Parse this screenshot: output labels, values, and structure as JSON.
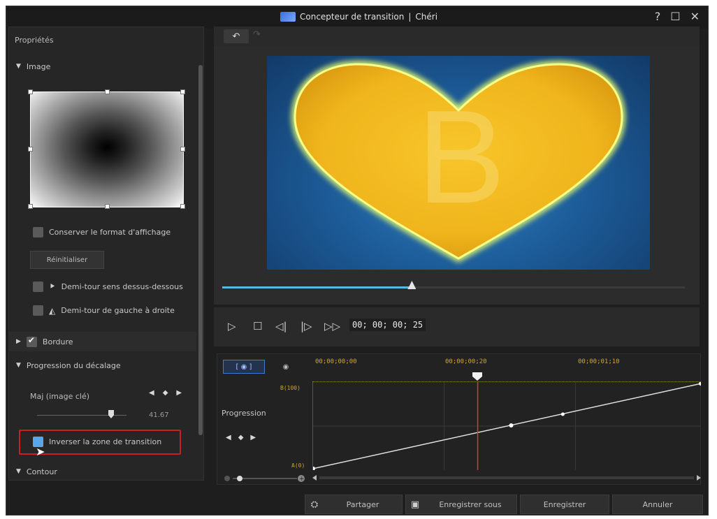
{
  "window": {
    "title": "Concepteur de transition",
    "project": "Chéri",
    "separator": "|",
    "controls": {
      "help": "?",
      "maximize": "☐",
      "close": "✕"
    }
  },
  "left_panel": {
    "heading": "Propriétés",
    "image_section": {
      "label": "Image",
      "expanded": true
    },
    "keep_aspect_label": "Conserver le format d'affichage",
    "reset_label": "Réinitialiser",
    "flip_vertical_label": "Demi-tour sens dessus-dessous",
    "flip_horizontal_label": "Demi-tour de gauche à droite",
    "border_section": {
      "label": "Bordure",
      "checked": true,
      "expanded": false
    },
    "offset_section": {
      "label": "Progression du décalage",
      "expanded": true
    },
    "maj_label": "Maj (image clé)",
    "maj_value": "41.67",
    "invert_label": "Inverser la zone de transition",
    "invert_checked": true,
    "contour_section": {
      "label": "Contour",
      "expanded": true
    }
  },
  "preview": {
    "letter": "B",
    "colors": {
      "heart": "#f2b81e",
      "glow": "#e9ff6a",
      "background": "#1d5d9a"
    },
    "seek_progress": 0.41
  },
  "transport": {
    "timecode": "00; 00; 00; 25",
    "buttons": [
      "play-icon",
      "stop-icon",
      "prev-frame-icon",
      "next-frame-icon",
      "fast-forward-icon"
    ]
  },
  "timeline": {
    "tab_a_icon": "keyframe-mode-icon",
    "tab_b_icon": "record-icon",
    "track_label": "Progression",
    "timecodes": [
      "00;00;00;00",
      "00;00;00;20",
      "00;00;01;10"
    ],
    "top_label": "B(100)",
    "bottom_label": "A(0)"
  },
  "footer": {
    "share": "Partager",
    "save_as": "Enregistrer sous",
    "save": "Enregistrer",
    "cancel": "Annuler"
  }
}
